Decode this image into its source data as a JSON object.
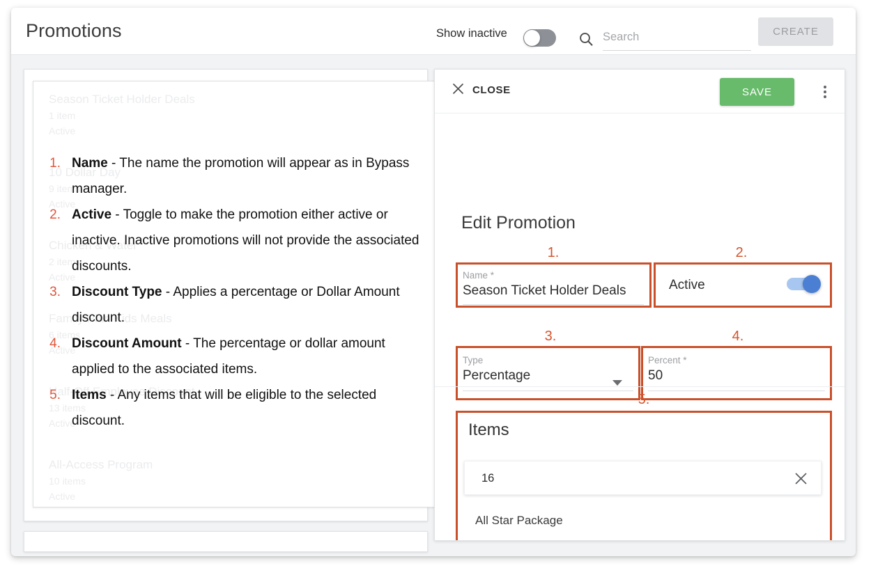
{
  "header": {
    "title": "Promotions",
    "show_inactive_label": "Show inactive",
    "show_inactive_state": "off",
    "search_placeholder": "Search",
    "search_value": "",
    "create_label": "CREATE"
  },
  "promotions_list": [
    {
      "name": "Season Ticket Holder Deals",
      "count": "1 item",
      "status": "Active"
    },
    {
      "name": "10 Dollar Day",
      "count": "9 items",
      "status": "Active"
    },
    {
      "name": "Chicken & Water",
      "count": "2 items",
      "status": "Active"
    },
    {
      "name": "Family Plan Kids Meals",
      "count": "6 items",
      "status": "Active"
    },
    {
      "name": "Half-Off Employee Discount",
      "count": "13 items",
      "status": "Active"
    },
    {
      "name": "All-Access Program",
      "count": "10 items",
      "status": "Active"
    }
  ],
  "instructions": [
    {
      "num": "1.",
      "term": "Name",
      "rest": " - The name the promotion will appear as in Bypass manager."
    },
    {
      "num": "2.",
      "term": "Active",
      "rest": " - Toggle to make the promotion either active or inactive. Inactive promotions will not provide the associated discounts."
    },
    {
      "num": "3.",
      "term": "Discount Type",
      "rest": " - Applies a percentage or Dollar Amount discount."
    },
    {
      "num": "4.",
      "term": "Discount Amount",
      "rest": " - The percentage or dollar amount applied to the associated items."
    },
    {
      "num": "5.",
      "term": "Items",
      "rest": " - Any items that will be eligible to the selected discount."
    }
  ],
  "panel": {
    "close_label": "CLOSE",
    "save_label": "SAVE",
    "title": "Edit Promotion",
    "name_field": {
      "label": "Name *",
      "value": "Season Ticket Holder Deals",
      "annotation": "1."
    },
    "active_field": {
      "label": "Active",
      "state": "on",
      "annotation": "2."
    },
    "type_field": {
      "label": "Type",
      "value": "Percentage",
      "annotation": "3."
    },
    "percent_field": {
      "label": "Percent *",
      "value": "50",
      "annotation": "4."
    },
    "items_section": {
      "title": "Items",
      "annotation": "5.",
      "search_value": "16",
      "result": "All Star Package"
    }
  },
  "colors": {
    "annotation": "#c8502a",
    "save_green": "#67bb6a",
    "toggle_blue": "#4a7fd4",
    "list_number": "#e1543a"
  }
}
